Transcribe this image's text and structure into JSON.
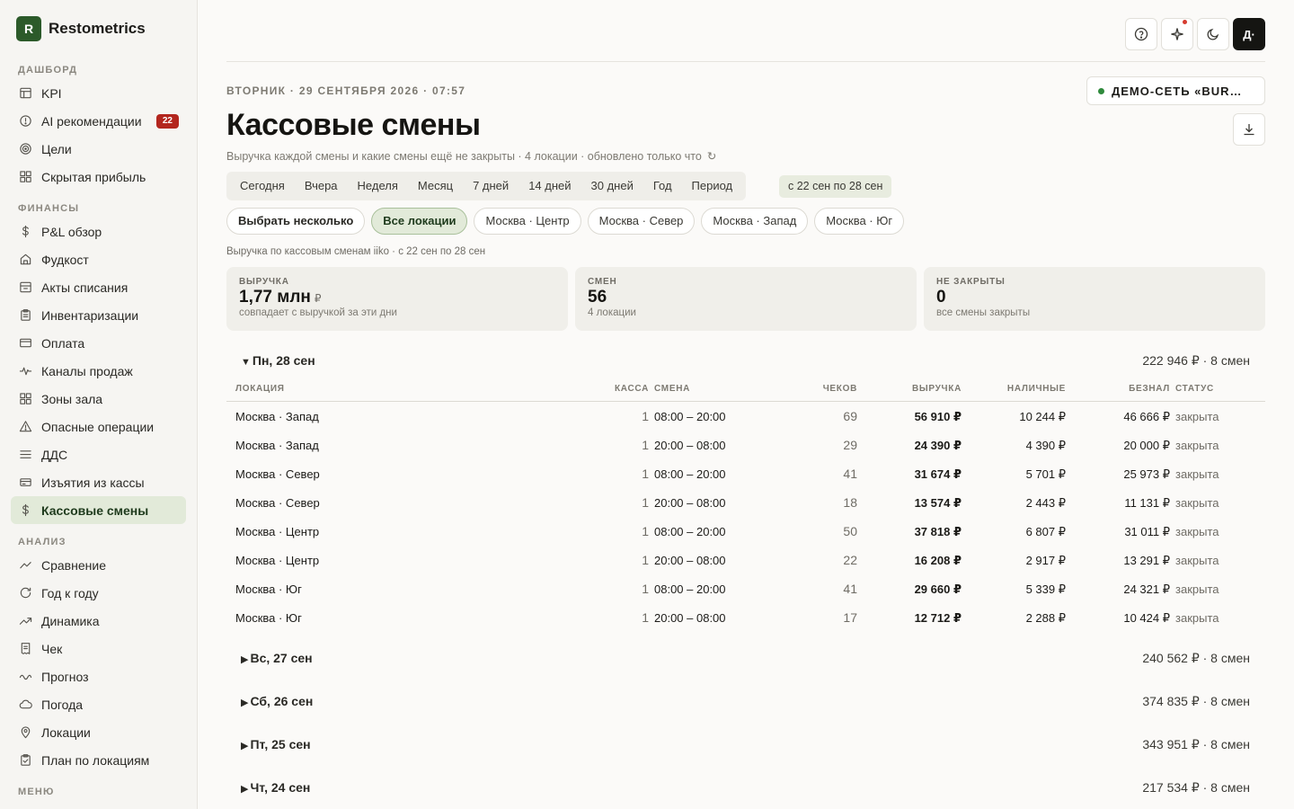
{
  "brand": {
    "logo_letter": "R",
    "name": "Restometrics"
  },
  "sidebar": {
    "sections": [
      {
        "label": "ДАШБОРД",
        "items": [
          {
            "label": "KPI",
            "icon": "table-icon"
          },
          {
            "label": "AI рекомендации",
            "icon": "alert-circle-icon",
            "badge": "22"
          },
          {
            "label": "Цели",
            "icon": "target-icon"
          },
          {
            "label": "Скрытая прибыль",
            "icon": "grid-icon"
          }
        ]
      },
      {
        "label": "ФИНАНСЫ",
        "items": [
          {
            "label": "P&L обзор",
            "icon": "dollar-icon"
          },
          {
            "label": "Фудкост",
            "icon": "home-icon"
          },
          {
            "label": "Акты списания",
            "icon": "archive-icon"
          },
          {
            "label": "Инвентаризации",
            "icon": "clipboard-icon"
          },
          {
            "label": "Оплата",
            "icon": "card-icon"
          },
          {
            "label": "Каналы продаж",
            "icon": "pulse-icon"
          },
          {
            "label": "Зоны зала",
            "icon": "grid-icon"
          },
          {
            "label": "Опасные операции",
            "icon": "warning-icon"
          },
          {
            "label": "ДДС",
            "icon": "menu-icon"
          },
          {
            "label": "Изъятия из кассы",
            "icon": "cash-icon"
          },
          {
            "label": "Кассовые смены",
            "icon": "dollar-icon",
            "active": true
          }
        ]
      },
      {
        "label": "АНАЛИЗ",
        "items": [
          {
            "label": "Сравнение",
            "icon": "chevron-up-icon"
          },
          {
            "label": "Год к году",
            "icon": "refresh-icon"
          },
          {
            "label": "Динамика",
            "icon": "trend-icon"
          },
          {
            "label": "Чек",
            "icon": "receipt-icon"
          },
          {
            "label": "Прогноз",
            "icon": "wave-icon"
          },
          {
            "label": "Погода",
            "icon": "cloud-icon"
          },
          {
            "label": "Локации",
            "icon": "pin-icon"
          },
          {
            "label": "План по локациям",
            "icon": "clipboard-check-icon"
          }
        ]
      },
      {
        "label": "МЕНЮ",
        "items": []
      }
    ]
  },
  "topbar": {
    "avatar": "Д·"
  },
  "header": {
    "dateline": "ВТОРНИК · 29 СЕНТЯБРЯ 2026 · 07:57",
    "network": "ДЕМО-СЕТЬ «BUR…",
    "title": "Кассовые смены",
    "subtitle": "Выручка каждой смены и какие смены ещё не закрыты · 4 локации · обновлено только что",
    "refresh_glyph": "↻"
  },
  "periods": [
    "Сегодня",
    "Вчера",
    "Неделя",
    "Месяц",
    "7 дней",
    "14 дней",
    "30 дней",
    "Год",
    "Период"
  ],
  "period_range": "с 22 сен по 28 сен",
  "locations": [
    {
      "label": "Выбрать несколько",
      "kind": "first"
    },
    {
      "label": "Все локации",
      "kind": "active"
    },
    {
      "label": "Москва · Центр",
      "kind": ""
    },
    {
      "label": "Москва · Север",
      "kind": ""
    },
    {
      "label": "Москва · Запад",
      "kind": ""
    },
    {
      "label": "Москва · Юг",
      "kind": ""
    }
  ],
  "caption": "Выручка по кассовым сменам iiko · с 22 сен по 28 сен",
  "kpis": [
    {
      "label": "ВЫРУЧКА",
      "value": "1,77 млн",
      "unit": "₽",
      "note": "совпадает с выручкой за эти дни"
    },
    {
      "label": "СМЕН",
      "value": "56",
      "unit": "",
      "note": "4 локации"
    },
    {
      "label": "НЕ ЗАКРЫТЫ",
      "value": "0",
      "unit": "",
      "note": "все смены закрыты"
    }
  ],
  "table_headers": {
    "loc": "ЛОКАЦИЯ",
    "kassa": "КАССА",
    "shift": "СМЕНА",
    "checks": "ЧЕКОВ",
    "rev": "ВЫРУЧКА",
    "cash": "НАЛИЧНЫЕ",
    "card": "БЕЗНАЛ",
    "status": "СТАТУС"
  },
  "days": [
    {
      "title": "Пн, 28 сен",
      "summary": "222 946 ₽ · 8 смен",
      "expanded": true,
      "rows": [
        {
          "loc": "Москва · Запад",
          "kassa": "1",
          "shift": "08:00 – 20:00",
          "checks": "69",
          "rev": "56 910 ₽",
          "cash": "10 244 ₽",
          "card": "46 666 ₽",
          "status": "закрыта"
        },
        {
          "loc": "Москва · Запад",
          "kassa": "1",
          "shift": "20:00 – 08:00",
          "checks": "29",
          "rev": "24 390 ₽",
          "cash": "4 390 ₽",
          "card": "20 000 ₽",
          "status": "закрыта"
        },
        {
          "loc": "Москва · Север",
          "kassa": "1",
          "shift": "08:00 – 20:00",
          "checks": "41",
          "rev": "31 674 ₽",
          "cash": "5 701 ₽",
          "card": "25 973 ₽",
          "status": "закрыта"
        },
        {
          "loc": "Москва · Север",
          "kassa": "1",
          "shift": "20:00 – 08:00",
          "checks": "18",
          "rev": "13 574 ₽",
          "cash": "2 443 ₽",
          "card": "11 131 ₽",
          "status": "закрыта"
        },
        {
          "loc": "Москва · Центр",
          "kassa": "1",
          "shift": "08:00 – 20:00",
          "checks": "50",
          "rev": "37 818 ₽",
          "cash": "6 807 ₽",
          "card": "31 011 ₽",
          "status": "закрыта"
        },
        {
          "loc": "Москва · Центр",
          "kassa": "1",
          "shift": "20:00 – 08:00",
          "checks": "22",
          "rev": "16 208 ₽",
          "cash": "2 917 ₽",
          "card": "13 291 ₽",
          "status": "закрыта"
        },
        {
          "loc": "Москва · Юг",
          "kassa": "1",
          "shift": "08:00 – 20:00",
          "checks": "41",
          "rev": "29 660 ₽",
          "cash": "5 339 ₽",
          "card": "24 321 ₽",
          "status": "закрыта"
        },
        {
          "loc": "Москва · Юг",
          "kassa": "1",
          "shift": "20:00 – 08:00",
          "checks": "17",
          "rev": "12 712 ₽",
          "cash": "2 288 ₽",
          "card": "10 424 ₽",
          "status": "закрыта"
        }
      ]
    },
    {
      "title": "Вс, 27 сен",
      "summary": "240 562 ₽ · 8 смен",
      "expanded": false,
      "rows": []
    },
    {
      "title": "Сб, 26 сен",
      "summary": "374 835 ₽ · 8 смен",
      "expanded": false,
      "rows": []
    },
    {
      "title": "Пт, 25 сен",
      "summary": "343 951 ₽ · 8 смен",
      "expanded": false,
      "rows": []
    },
    {
      "title": "Чт, 24 сен",
      "summary": "217 534 ₽ · 8 смен",
      "expanded": false,
      "rows": []
    }
  ]
}
